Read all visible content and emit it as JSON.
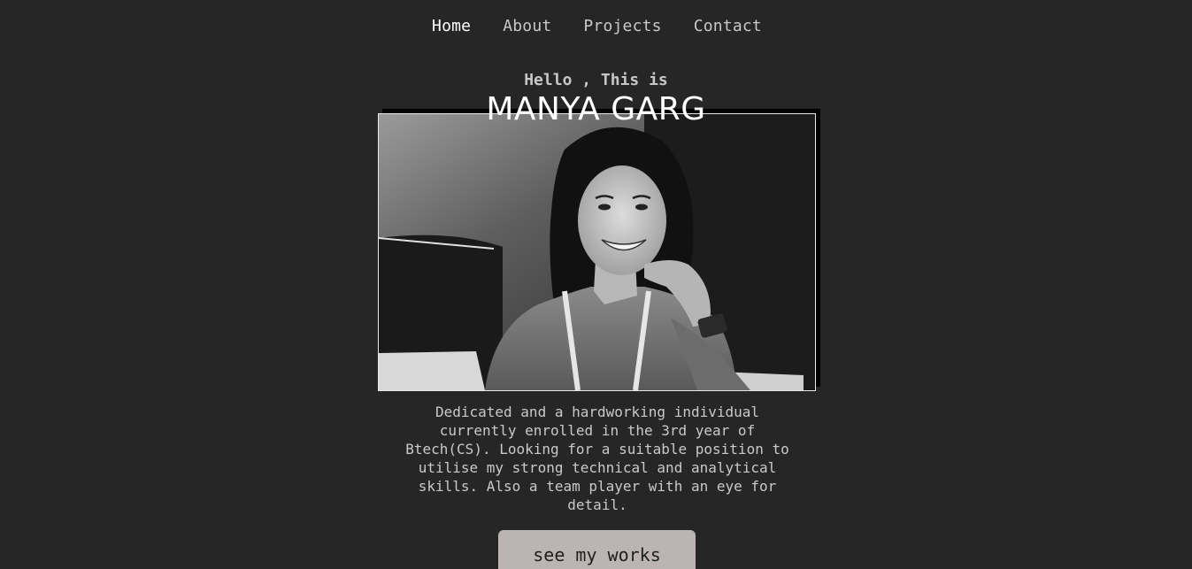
{
  "nav": {
    "items": [
      {
        "label": "Home",
        "active": true
      },
      {
        "label": "About",
        "active": false
      },
      {
        "label": "Projects",
        "active": false
      },
      {
        "label": "Contact",
        "active": false
      }
    ]
  },
  "hero": {
    "greeting": "Hello , This is",
    "name": "MANYA GARG",
    "bio": "Dedicated and a hardworking individual currently enrolled in the 3rd year of Btech(CS). Looking for a suitable position to utilise my strong technical and analytical skills. Also a team player with an eye for detail.",
    "cta_label": "see my works"
  },
  "photo": {
    "subject": "portrait-photo",
    "style": "black-and-white"
  },
  "colors": {
    "background": "#262626",
    "nav_text": "#c8c8c8",
    "nav_active": "#ffffff",
    "button_bg": "#bcb3b3"
  }
}
